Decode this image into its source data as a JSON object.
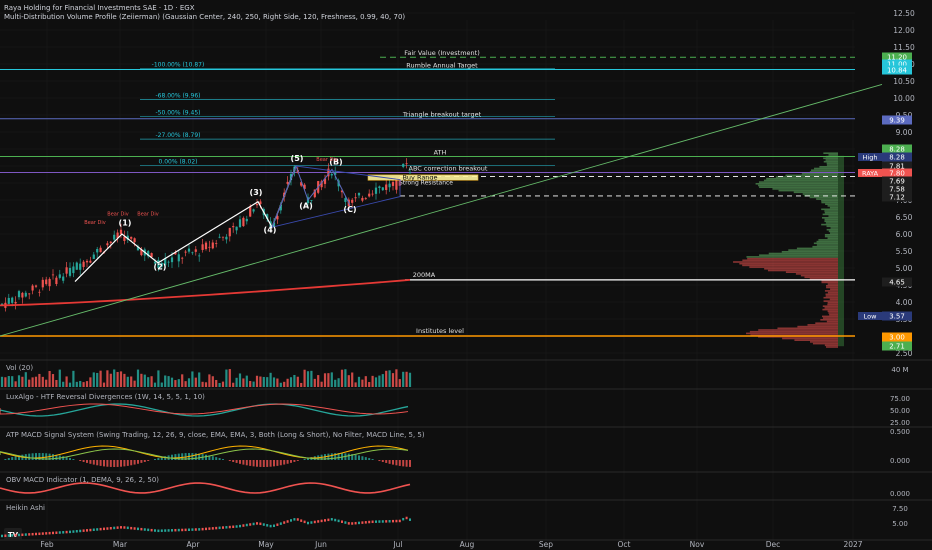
{
  "header": {
    "title": "Raya Holding for Financial Investments SAE · 1D · EGX",
    "subtitle": "Multi-Distribution Volume Profile (Zeiierman) (Gaussian Center, 240, 250, Right Side, 120, Freshness, 0.99, 40, 70)"
  },
  "colors": {
    "bg": "#0f0f0f",
    "up": "#26a69a",
    "down": "#ef5350",
    "green_line": "#66bb6a",
    "ma200": "#e53935",
    "purple": "#7e57c2",
    "blue": "#5c6bc0",
    "orange": "#ff9800",
    "fib": "#26c6da",
    "wave": "#ffffff"
  },
  "chart_data": [
    {
      "type": "candlestick",
      "title": "Raya Holding for Financial Investments SAE · 1D · EGX",
      "y_axis_ticks": [
        "12.50",
        "12.00",
        "11.50",
        "11.00",
        "10.50",
        "10.00",
        "9.50",
        "9.00",
        "8.50",
        "8.00",
        "7.50",
        "7.00",
        "6.50",
        "6.00",
        "5.50",
        "5.00",
        "4.50",
        "4.00",
        "3.50",
        "3.00",
        "2.50"
      ],
      "x_axis_ticks": [
        "Feb",
        "Mar",
        "Apr",
        "May",
        "Jun",
        "Jul",
        "Aug",
        "Sep",
        "Oct",
        "Nov",
        "Dec",
        "2027"
      ],
      "price_labels": [
        {
          "value": "11.20",
          "color": "#4caf50"
        },
        {
          "value": "11.00",
          "color": "#26c6da"
        },
        {
          "value": "10.84",
          "color": "#26c6da"
        },
        {
          "value": "9.39",
          "color": "#5c6bc0"
        },
        {
          "value": "8.28",
          "color": "#4caf50"
        },
        {
          "value": "8.28",
          "tag": "High",
          "color": "#2a3a7a"
        },
        {
          "value": "7.81",
          "color": "#1e1e1e"
        },
        {
          "value": "7.80",
          "tag": "RAYA",
          "color": "#ef5350"
        },
        {
          "value": "7.69",
          "color": "#1e1e1e"
        },
        {
          "value": "7.58",
          "color": "#1e1e1e"
        },
        {
          "value": "7.12",
          "color": "#1e1e1e"
        },
        {
          "value": "4.65",
          "color": "#1e1e1e"
        },
        {
          "value": "3.57",
          "tag": "Low",
          "color": "#2a3a7a"
        },
        {
          "value": "3.00",
          "color": "#ff9800"
        },
        {
          "value": "2.71",
          "color": "#4caf50"
        }
      ],
      "levels": [
        {
          "label": "Fair Value (Investment)",
          "value": 11.2
        },
        {
          "label": "Rumble Annual Target",
          "value": 10.84
        },
        {
          "label": "Triangle breakout target",
          "value": 9.39
        },
        {
          "label": "ATH",
          "value": 8.28
        },
        {
          "label": "ABC correction breakout",
          "value": 7.81
        },
        {
          "label": "Buy Range",
          "value": 7.69
        },
        {
          "label": "Strong Resistance",
          "value": 7.58
        },
        {
          "label": "200MA",
          "value": 4.65
        },
        {
          "label": "Institutes level",
          "value": 3.0
        }
      ],
      "fib_levels": [
        {
          "label": "-100.00% (10.87)",
          "value": 10.87
        },
        {
          "label": "-68.00% (9.96)",
          "value": 9.96
        },
        {
          "label": "-50.00% (9.45)",
          "value": 9.45
        },
        {
          "label": "-27.00% (8.79)",
          "value": 8.79
        },
        {
          "label": "0.00% (8.02)",
          "value": 8.02
        }
      ],
      "wave_labels": [
        "(1)",
        "(2)",
        "(3)",
        "(4)",
        "(5)",
        "(A)",
        "(B)",
        "(C)"
      ],
      "divergence_labels": [
        "Bear Div",
        "Bear Div",
        "Bear Div",
        "Bear Div"
      ],
      "last_price": 7.8
    }
  ],
  "panes": {
    "volume": {
      "label": "Vol (20)",
      "axis": [
        "40 M"
      ]
    },
    "luxalgo": {
      "label": "LuxAlgo - HTF Reversal Divergences (1W, 14, 5, 5, 1, 10)",
      "axis": [
        "75.00",
        "50.00",
        "25.00"
      ]
    },
    "macd": {
      "label": "ATP MACD Signal System (Swing Trading, 12, 26, 9, close, EMA, EMA, 3, Both (Long & Short), No Filter, MACD Line, 5, 5)",
      "axis": [
        "0.500",
        "0.000"
      ]
    },
    "obv": {
      "label": "OBV MACD Indicator (1, DEMA, 9, 26, 2, 50)",
      "axis": [
        "0.000"
      ]
    },
    "heikin": {
      "label": "Heikin Ashi",
      "axis": [
        "7.50",
        "5.00"
      ]
    }
  },
  "footer": {
    "logo": "TV"
  }
}
